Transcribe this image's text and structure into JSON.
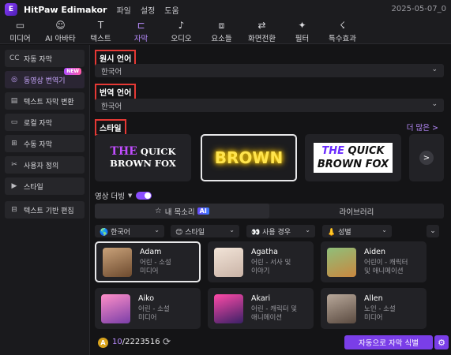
{
  "app": {
    "title": "HitPaw Edimakor",
    "logo_letter": "E",
    "menus": [
      "파일",
      "설정",
      "도움"
    ],
    "datetime": "2025-05-07_0"
  },
  "toolbar": [
    {
      "label": "미디어",
      "icon": "media-icon",
      "glyph": "▭"
    },
    {
      "label": "AI 아바타",
      "icon": "avatar-icon",
      "glyph": "☺"
    },
    {
      "label": "텍스트",
      "icon": "text-icon",
      "glyph": "T"
    },
    {
      "label": "자막",
      "icon": "subtitle-icon",
      "glyph": "⊏",
      "active": true
    },
    {
      "label": "오디오",
      "icon": "audio-icon",
      "glyph": "♪"
    },
    {
      "label": "요소들",
      "icon": "elements-icon",
      "glyph": "⧈"
    },
    {
      "label": "화면전환",
      "icon": "transition-icon",
      "glyph": "⇄"
    },
    {
      "label": "필터",
      "icon": "filter-icon",
      "glyph": "✦"
    },
    {
      "label": "특수효과",
      "icon": "effects-icon",
      "glyph": "☇"
    }
  ],
  "sidebar": {
    "items": [
      {
        "label": "자동 자막",
        "icon": "cc-icon",
        "glyph": "CC"
      },
      {
        "label": "동영상 번역기",
        "icon": "translate-icon",
        "glyph": "◎",
        "active": true,
        "badge": "NEW"
      },
      {
        "label": "텍스트 자막 변환",
        "icon": "text-subtitle-icon",
        "glyph": "▤"
      },
      {
        "label": "로컬 자막",
        "icon": "local-subtitle-icon",
        "glyph": "▭"
      },
      {
        "label": "수동 자막",
        "icon": "manual-subtitle-icon",
        "glyph": "⊞"
      },
      {
        "label": "사용자 정의",
        "icon": "custom-icon",
        "glyph": "✂"
      },
      {
        "label": "스타일",
        "icon": "caret-right-icon",
        "glyph": "▶"
      },
      {
        "label": "텍스트 기반 편집",
        "icon": "text-edit-icon",
        "glyph": "⊟"
      }
    ]
  },
  "main": {
    "source_lang": {
      "label": "원시 언어",
      "value": "한국어"
    },
    "target_lang": {
      "label": "번역 언어",
      "value": "한국어"
    },
    "style": {
      "label": "스타일",
      "more": "더 많은 >",
      "cards": {
        "c1_line1": "THE",
        "c1_line1b": "QUICK",
        "c1_line2": "BROWN FOX",
        "c2": "BROWN",
        "c3_line1a": "THE",
        "c3_line1b": "QUICK",
        "c3_line2": "BROWN FOX",
        "next": ">"
      }
    },
    "dubbing": {
      "label": "영상 더빙",
      "caret": "▼",
      "enabled": true
    },
    "tabs": {
      "my_voice": "내 목소리",
      "ai": "AI",
      "library": "라이브러리"
    },
    "filters": [
      {
        "label": "🌎 한국어"
      },
      {
        "label": "😊 스타일"
      },
      {
        "label": "👀 사용 경우"
      },
      {
        "label": "👃 성별"
      }
    ],
    "voices": [
      {
        "name": "Adam",
        "desc": "어린 - 소설\n미디어"
      },
      {
        "name": "Agatha",
        "desc": "어린 - 서사 및\n이야기"
      },
      {
        "name": "Aiden",
        "desc": "어린이 - 캐릭터\n및 애니메이션"
      },
      {
        "name": "Aiko",
        "desc": "어린 - 소설\n미디어"
      },
      {
        "name": "Akari",
        "desc": "어린 - 캐릭터 및\n애니메이션"
      },
      {
        "name": "Allen",
        "desc": "노인 - 소설\n미디어"
      }
    ],
    "credits": {
      "coin": "A",
      "used": "10",
      "total": "/2223516"
    },
    "detect_button": "자동으로 자막 식별"
  }
}
